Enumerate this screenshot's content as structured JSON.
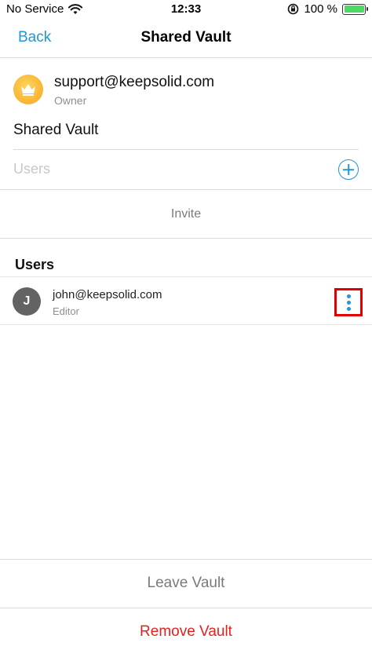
{
  "status_bar": {
    "carrier": "No Service",
    "time": "12:33",
    "battery_percent": "100 %",
    "battery_level": 1.0,
    "icons": [
      "wifi-icon",
      "orientation-lock-icon",
      "battery-icon"
    ]
  },
  "nav": {
    "back_label": "Back",
    "title": "Shared Vault"
  },
  "owner": {
    "email": "support@keepsolid.com",
    "role": "Owner",
    "badge_icon": "crown-icon"
  },
  "vault": {
    "name": "Shared Vault"
  },
  "users_field": {
    "placeholder": "Users",
    "add_icon": "add-circle-icon"
  },
  "invite": {
    "label": "Invite"
  },
  "users_section": {
    "title": "Users",
    "items": [
      {
        "initial": "J",
        "email": "john@keepsolid.com",
        "role": "Editor",
        "menu_icon": "more-vertical-icon"
      }
    ]
  },
  "actions": {
    "leave_label": "Leave Vault",
    "remove_label": "Remove Vault"
  },
  "colors": {
    "accent": "#2196d8",
    "destructive": "#e8201d",
    "highlight_box": "#e00000",
    "battery": "#4cd964",
    "crown_badge": "#f5a623"
  }
}
